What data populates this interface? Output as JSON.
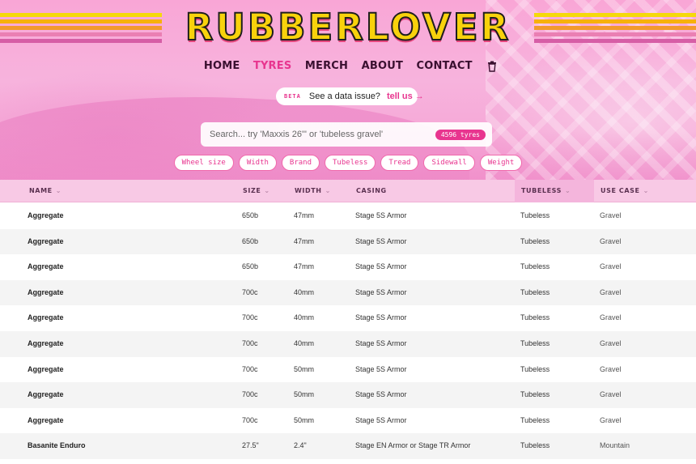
{
  "brand": {
    "logo_text": "RUBBERLOVER"
  },
  "nav": {
    "items": [
      "HOME",
      "TYRES",
      "MERCH",
      "ABOUT",
      "CONTACT"
    ],
    "active": "TYRES",
    "cart_icon": "trash-icon"
  },
  "beta": {
    "tag": "BETA",
    "message": "See a data issue?",
    "link": "tell us →"
  },
  "search": {
    "placeholder": "Search... try 'Maxxis 26\"' or 'tubeless gravel'",
    "value": "",
    "count": "4596 tyres"
  },
  "filters": [
    "Wheel size",
    "Width",
    "Brand",
    "Tubeless",
    "Tread",
    "Sidewall",
    "Weight"
  ],
  "table": {
    "columns": [
      {
        "key": "name",
        "label": "NAME",
        "sortable": true
      },
      {
        "key": "size",
        "label": "SIZE",
        "sortable": true
      },
      {
        "key": "width",
        "label": "WIDTH",
        "sortable": true
      },
      {
        "key": "casing",
        "label": "CASING",
        "sortable": false
      },
      {
        "key": "tubeless",
        "label": "TUBELESS",
        "sortable": true
      },
      {
        "key": "use",
        "label": "USE CASE",
        "sortable": true
      }
    ],
    "rows": [
      {
        "name": "Aggregate",
        "size": "650b",
        "width": "47mm",
        "casing": "Stage 5S Armor",
        "tubeless": "Tubeless",
        "use": "Gravel"
      },
      {
        "name": "Aggregate",
        "size": "650b",
        "width": "47mm",
        "casing": "Stage 5S Armor",
        "tubeless": "Tubeless",
        "use": "Gravel"
      },
      {
        "name": "Aggregate",
        "size": "650b",
        "width": "47mm",
        "casing": "Stage 5S Armor",
        "tubeless": "Tubeless",
        "use": "Gravel"
      },
      {
        "name": "Aggregate",
        "size": "700c",
        "width": "40mm",
        "casing": "Stage 5S Armor",
        "tubeless": "Tubeless",
        "use": "Gravel"
      },
      {
        "name": "Aggregate",
        "size": "700c",
        "width": "40mm",
        "casing": "Stage 5S Armor",
        "tubeless": "Tubeless",
        "use": "Gravel"
      },
      {
        "name": "Aggregate",
        "size": "700c",
        "width": "40mm",
        "casing": "Stage 5S Armor",
        "tubeless": "Tubeless",
        "use": "Gravel"
      },
      {
        "name": "Aggregate",
        "size": "700c",
        "width": "50mm",
        "casing": "Stage 5S Armor",
        "tubeless": "Tubeless",
        "use": "Gravel"
      },
      {
        "name": "Aggregate",
        "size": "700c",
        "width": "50mm",
        "casing": "Stage 5S Armor",
        "tubeless": "Tubeless",
        "use": "Gravel"
      },
      {
        "name": "Aggregate",
        "size": "700c",
        "width": "50mm",
        "casing": "Stage 5S Armor",
        "tubeless": "Tubeless",
        "use": "Gravel"
      },
      {
        "name": "Basanite Enduro",
        "size": "27.5\"",
        "width": "2.4\"",
        "casing": "Stage EN Armor or Stage TR Armor",
        "tubeless": "Tubeless",
        "use": "Mountain"
      }
    ]
  },
  "colors": {
    "accent": "#e8358f",
    "logo_fill": "#f8d20c",
    "header_bg": "#f8c9e5",
    "hero_bg": "#f7b3dd"
  }
}
